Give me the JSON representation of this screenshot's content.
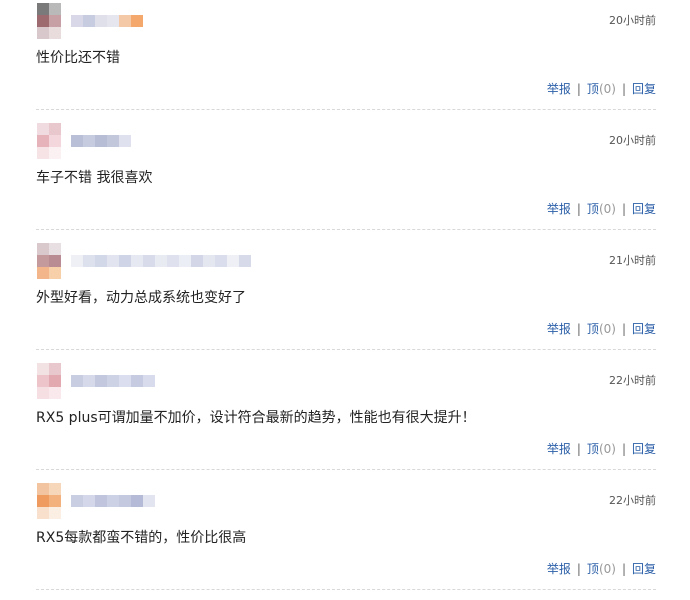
{
  "comments": [
    {
      "timestamp": "20小时前",
      "content": "性价比还不错",
      "avatar_colors": [
        "#7a7a7a",
        "#b9b9b9",
        "#9c6a6f",
        "#c7a0a6",
        "#d9c8cb",
        "#e9dcdc"
      ],
      "username_colors": [
        "#d8d8e8",
        "#c8cce0",
        "#dfe0ea",
        "#e6e6ee",
        "#f3c9a8",
        "#f5a86c"
      ]
    },
    {
      "timestamp": "20小时前",
      "content": "车子不错 我很喜欢",
      "avatar_colors": [
        "#f0dce0",
        "#e8c7cd",
        "#e6b3bb",
        "#f3d7dc",
        "#f5e3e6",
        "#fbf1f2"
      ],
      "username_colors": [
        "#b9bfd6",
        "#c6cbe0",
        "#b7bdd4",
        "#c2c7dc",
        "#dfe2ee"
      ]
    },
    {
      "timestamp": "21小时前",
      "content": "外型好看，动力总成系统也变好了",
      "avatar_colors": [
        "#d9c9cc",
        "#e7dfe1",
        "#c59a9d",
        "#b88c92",
        "#f3b58a",
        "#f7cfa8"
      ],
      "username_colors": [
        "#eef0f6",
        "#dde1ee",
        "#d3d8e9",
        "#e2e5f0",
        "#cfd4e6",
        "#e7e9f2",
        "#d8dcea",
        "#e9ebf3",
        "#dfe2ee",
        "#eceef5",
        "#d2d6e6",
        "#e5e7f0",
        "#dadeec",
        "#eff0f5",
        "#d6dae9"
      ]
    },
    {
      "timestamp": "22小时前",
      "content": "RX5 plus可谓加量不加价，设计符合最新的趋势，性能也有很大提升！",
      "avatar_colors": [
        "#f3e2e4",
        "#e9c8cd",
        "#ecc4ca",
        "#e3a9b1",
        "#f5dfe2",
        "#fae9ec"
      ],
      "username_colors": [
        "#c8cde2",
        "#d5d9ea",
        "#c3c8df",
        "#cdd2e5",
        "#dadeee",
        "#c6cbe1",
        "#d7dbec"
      ]
    },
    {
      "timestamp": "22小时前",
      "content": "RX5每款都蛮不错的，性价比很高",
      "avatar_colors": [
        "#f2c4a0",
        "#f6d7b9",
        "#ef9b5f",
        "#f3b27d",
        "#f8e0cc",
        "#fbefe3"
      ],
      "username_colors": [
        "#c9cee3",
        "#d3d7e9",
        "#c0c5dd",
        "#ccd1e5",
        "#c4c9df",
        "#b5bbd6",
        "#e2e5f0"
      ]
    }
  ],
  "actions": {
    "report": "举报",
    "upvote": "顶",
    "upvote_count": "(0)",
    "reply": "回复",
    "separator": "|"
  }
}
